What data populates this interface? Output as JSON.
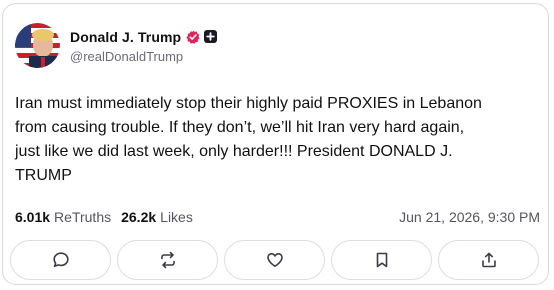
{
  "author": {
    "display_name": "Donald J. Trump",
    "handle": "@realDonaldTrump",
    "badges": [
      "verified-icon",
      "plus-icon"
    ],
    "verified_color": "#e0245e"
  },
  "post": {
    "text": "Iran must immediately stop their highly paid PROXIES in Lebanon\nfrom causing trouble. If they don’t, we’ll hit Iran very hard again,\njust like we did last week, only harder!!! President  DONALD J.\nTRUMP"
  },
  "stats": {
    "retruths_count": "6.01k",
    "retruths_label": "ReTruths",
    "likes_count": "26.2k",
    "likes_label": "Likes",
    "timestamp": "Jun 21, 2026, 9:30 PM"
  },
  "actions": [
    {
      "name": "reply",
      "icon": "comment-icon"
    },
    {
      "name": "retruth",
      "icon": "retruth-icon"
    },
    {
      "name": "like",
      "icon": "heart-icon"
    },
    {
      "name": "bookmark",
      "icon": "bookmark-icon"
    },
    {
      "name": "share",
      "icon": "share-icon"
    }
  ]
}
